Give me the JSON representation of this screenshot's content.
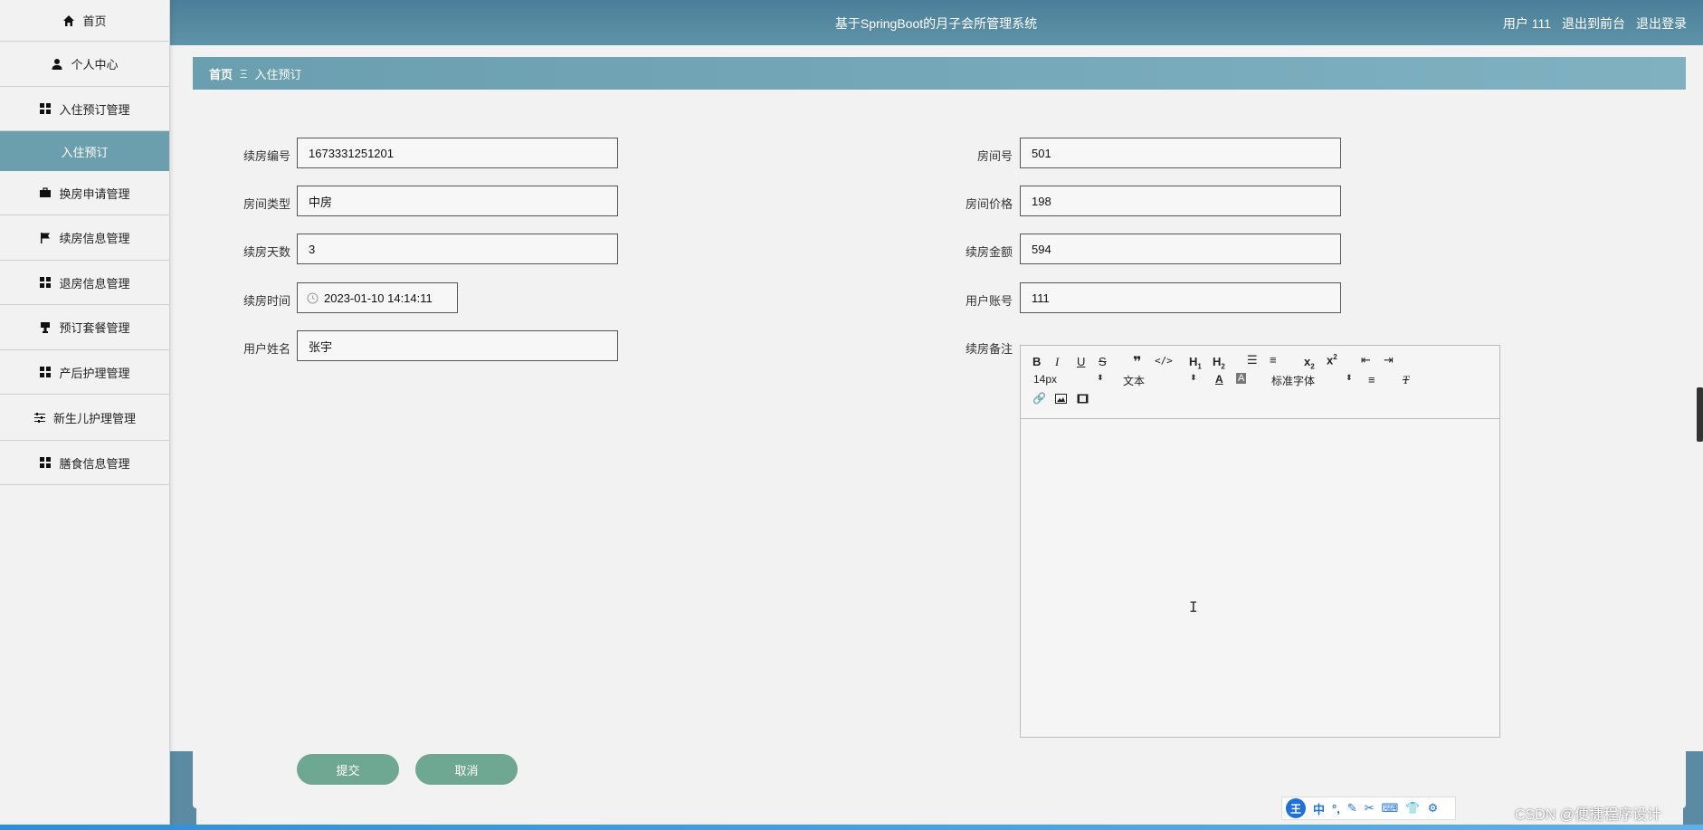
{
  "header": {
    "title": "基于SpringBoot的月子会所管理系统",
    "user_label": "用户 111",
    "back_label": "退出到前台",
    "logout_label": "退出登录"
  },
  "sidebar": {
    "items": [
      {
        "label": "首页",
        "icon": "home-icon"
      },
      {
        "label": "个人中心",
        "icon": "user-icon"
      },
      {
        "label": "入住预订管理",
        "icon": "grid-icon"
      },
      {
        "label": "入住预订",
        "icon": ""
      },
      {
        "label": "换房申请管理",
        "icon": "briefcase-icon"
      },
      {
        "label": "续房信息管理",
        "icon": "flag-icon"
      },
      {
        "label": "退房信息管理",
        "icon": "grid-icon"
      },
      {
        "label": "预订套餐管理",
        "icon": "stamp-icon"
      },
      {
        "label": "产后护理管理",
        "icon": "grid-icon"
      },
      {
        "label": "新生儿护理管理",
        "icon": "sliders-icon"
      },
      {
        "label": "膳食信息管理",
        "icon": "grid-icon"
      }
    ]
  },
  "breadcrumb": {
    "home": "首页",
    "separator": "Ξ",
    "current": "入住预订"
  },
  "form": {
    "left": [
      {
        "label": "续房编号",
        "value": "1673331251201"
      },
      {
        "label": "房间类型",
        "value": "中房"
      },
      {
        "label": "续房天数",
        "value": "3"
      },
      {
        "label": "续房时间",
        "value": "2023-01-10 14:14:11"
      },
      {
        "label": "用户姓名",
        "value": "张宇"
      }
    ],
    "right": [
      {
        "label": "房间号",
        "value": "501"
      },
      {
        "label": "房间价格",
        "value": "198"
      },
      {
        "label": "续房金额",
        "value": "594"
      },
      {
        "label": "用户账号",
        "value": "111"
      }
    ],
    "remark_label": "续房备注",
    "editor": {
      "font_size": "14px",
      "block_type": "文本",
      "font_family": "标准字体"
    },
    "submit_label": "提交",
    "cancel_label": "取消"
  },
  "taskbar": {
    "ime_logo": "王",
    "ime_mode": "中",
    "ime_punct": "°,",
    "watermark": "CSDN @便捷程序设计"
  },
  "colors": {
    "header": "#4b7f99",
    "breadcrumb": "#6a9fb0",
    "active_nav": "#6b9fad",
    "button": "#6fa892"
  }
}
